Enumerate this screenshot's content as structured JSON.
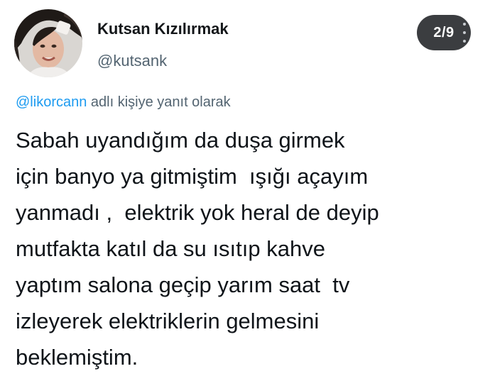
{
  "author": {
    "display_name": "Kutsan Kızılırmak",
    "handle": "@kutsank"
  },
  "media_counter": "2/9",
  "reply_context": {
    "mention": "@likorcann",
    "suffix": " adlı kişiye yanıt olarak"
  },
  "tweet": {
    "lines": [
      "Sabah uyandığım da duşa girmek",
      "için banyo ya gitmiştim  ışığı açayım",
      "yanmadı ,  elektrik yok heral de deyip",
      "mutfakta katıl da su ısıtıp kahve",
      "yaptım salona geçip yarım saat  tv",
      "izleyerek elektriklerin gelmesini",
      "beklemiştim."
    ]
  },
  "colors": {
    "link": "#1d9bf0",
    "secondary_text": "#536471",
    "badge_bg": "#3b3d40"
  },
  "icons": {
    "avatar": "profile-photo",
    "more": "vertical-more-icon"
  }
}
